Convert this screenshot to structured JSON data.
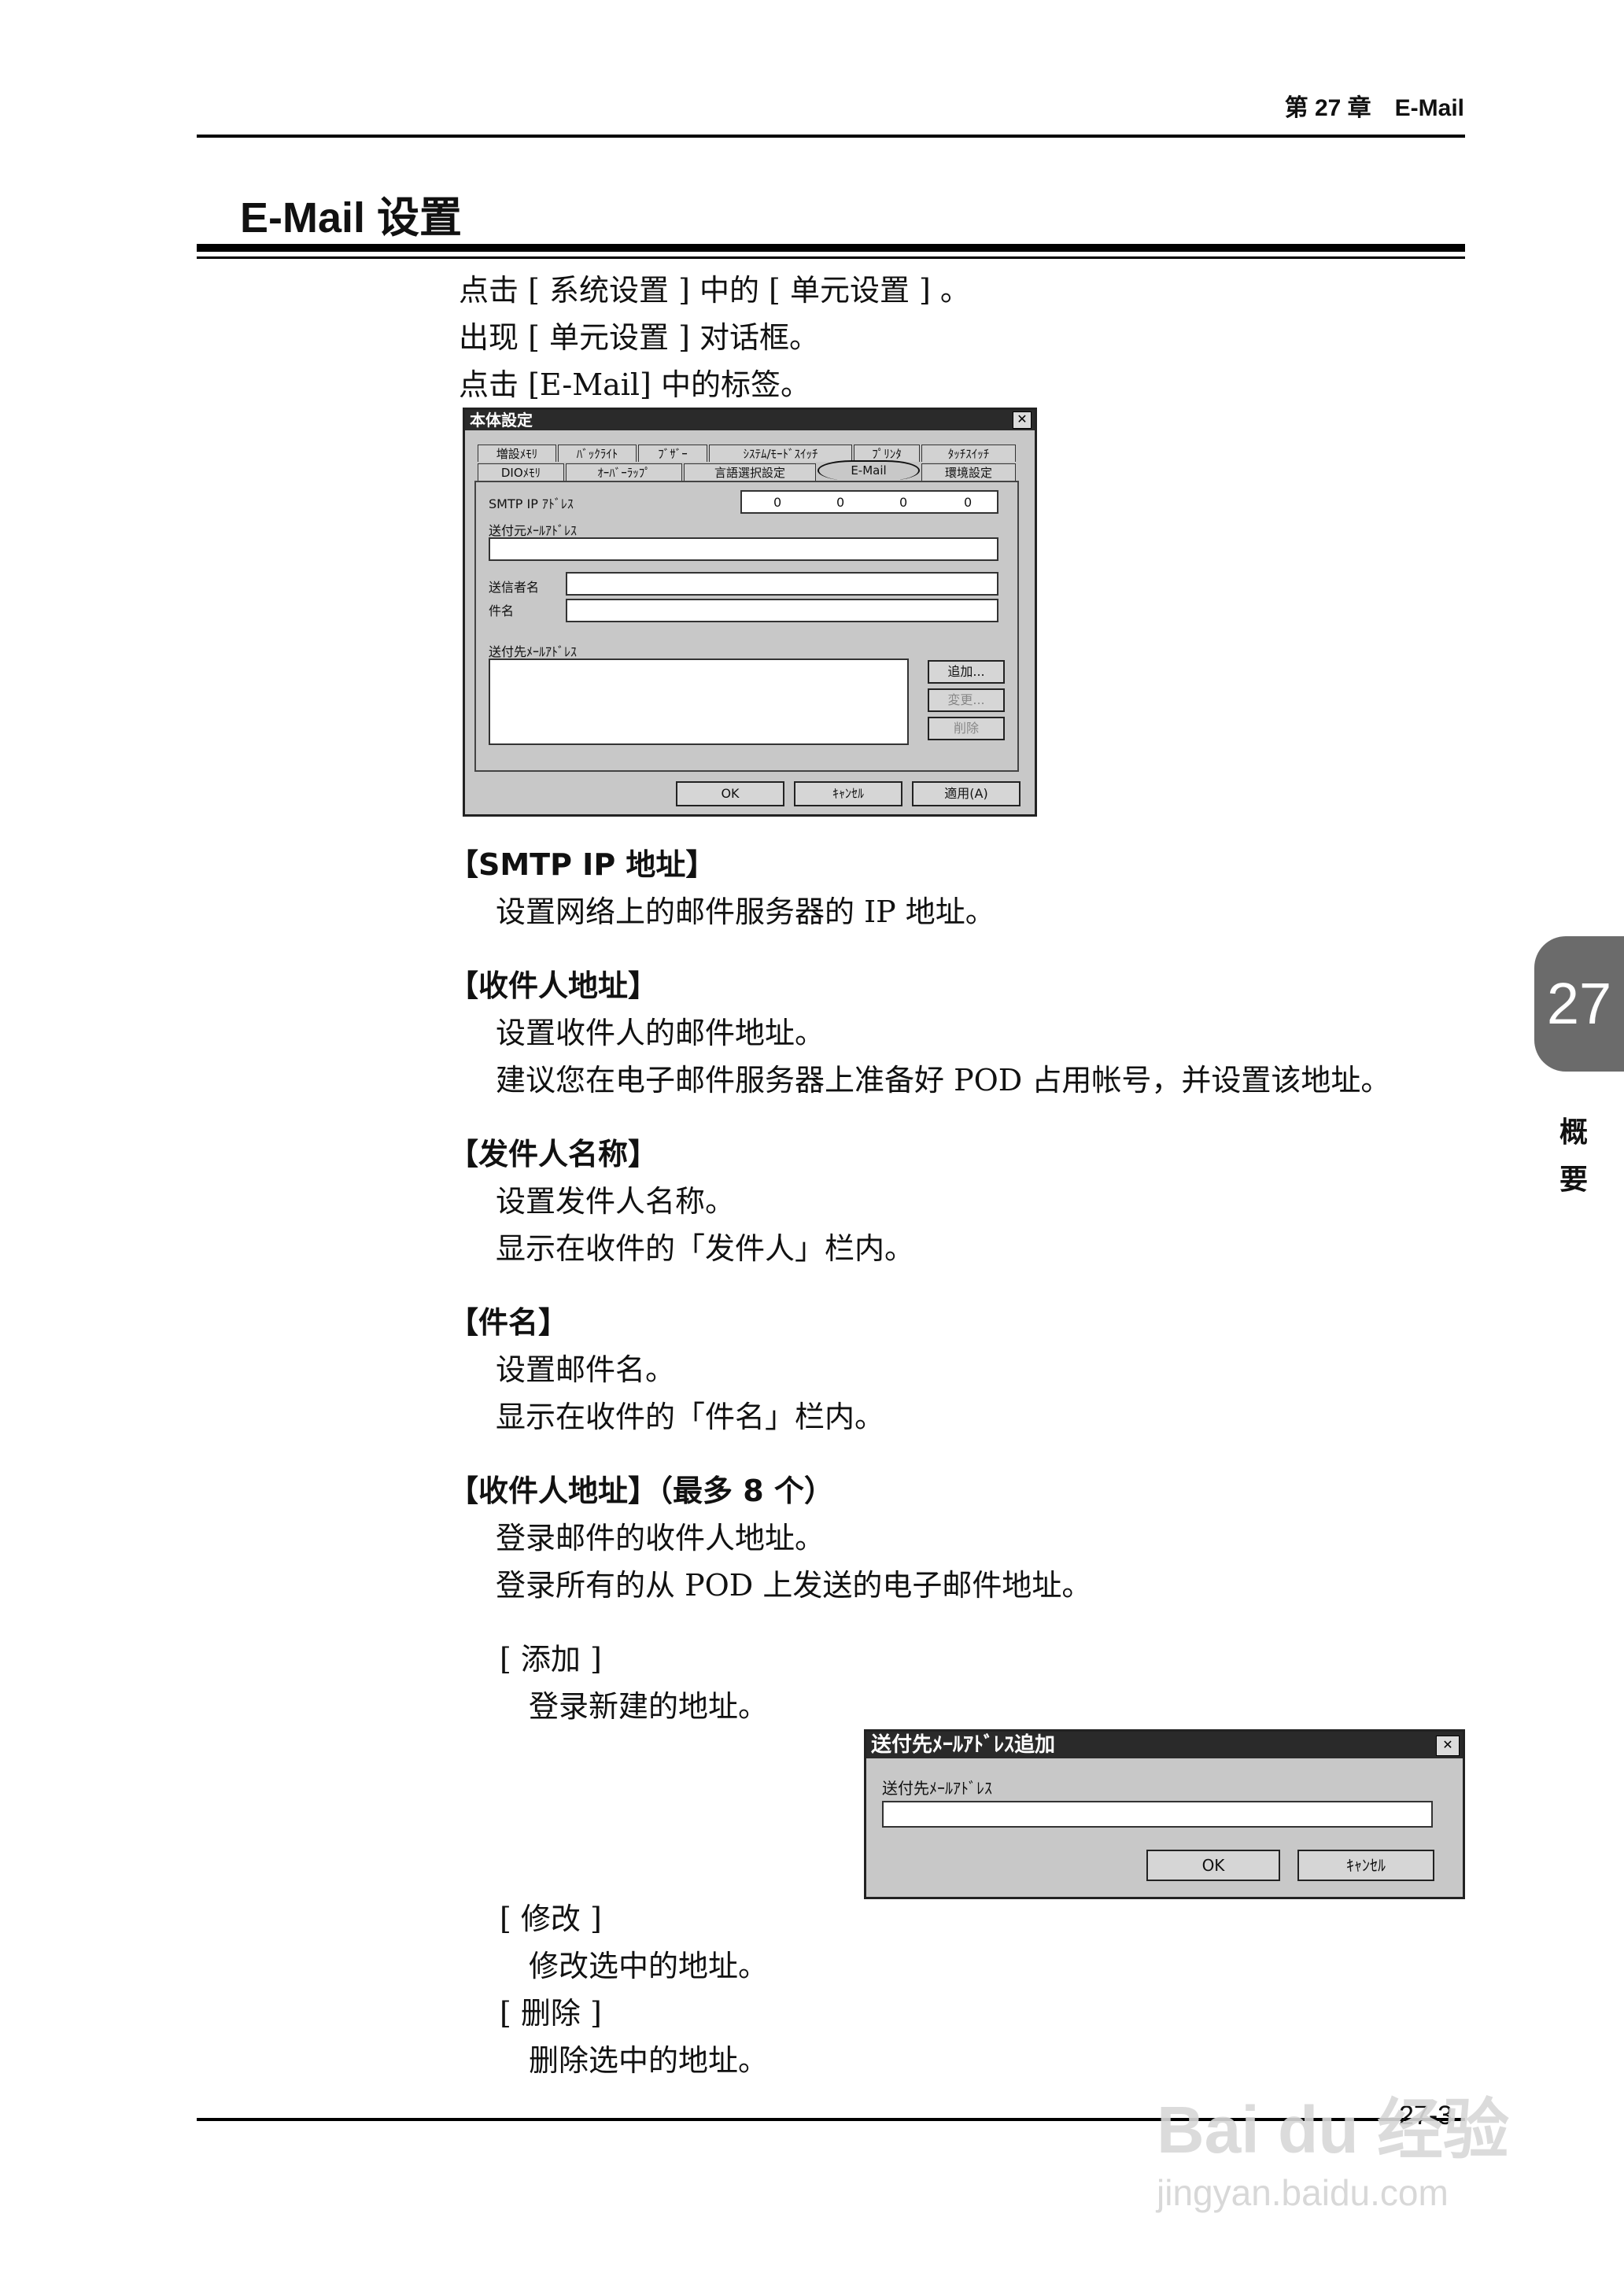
{
  "header": {
    "chapter_label": "第 27 章　E-Mail"
  },
  "title": "E-Mail 设置",
  "intro": [
    "点击 [ 系统设置 ] 中的 [ 单元设置 ] 。",
    "出现 [ 单元设置 ] 对话框。",
    "点击 [E-Mail] 中的标签。"
  ],
  "dialog_main": {
    "title": "本体設定",
    "tabs_row1": [
      "増設ﾒﾓﾘ",
      "ﾊﾞｯｸﾗｲﾄ",
      "ﾌﾞｻﾞｰ",
      "ｼｽﾃﾑ/ﾓｰﾄﾞｽｲｯﾁ",
      "ﾌﾟﾘﾝﾀ",
      "ﾀｯﾁｽｲｯﾁ"
    ],
    "tabs_row2": [
      "DIOﾒﾓﾘ",
      "ｵｰﾊﾞｰﾗｯﾌﾟ",
      "言語選択設定",
      "E-Mail",
      "環境設定"
    ],
    "smtp_label": "SMTP IP ｱﾄﾞﾚｽ",
    "ip_values": [
      "0",
      "0",
      "0",
      "0"
    ],
    "sender_addr_label": "送付元ﾒｰﾙｱﾄﾞﾚｽ",
    "sender_name_label": "送信者名",
    "subject_label": "件名",
    "dest_addr_label": "送付先ﾒｰﾙｱﾄﾞﾚｽ",
    "add_button": "追加...",
    "change_button": "変更...",
    "delete_button": "削除",
    "ok_button": "OK",
    "cancel_button": "ｷｬﾝｾﾙ",
    "apply_button": "適用(A)"
  },
  "sections": [
    {
      "head": "【SMTP IP 地址】",
      "lines": [
        "设置网络上的邮件服务器的 IP 地址。"
      ]
    },
    {
      "head": "【收件人地址】",
      "lines": [
        "设置收件人的邮件地址。",
        "建议您在电子邮件服务器上准备好 POD 占用帐号，并设置该地址。"
      ]
    },
    {
      "head": "【发件人名称】",
      "lines": [
        "设置发件人名称。",
        "显示在收件的「发件人」栏内。"
      ]
    },
    {
      "head": "【件名】",
      "lines": [
        "设置邮件名。",
        "显示在收件的「件名」栏内。"
      ]
    },
    {
      "head": "【收件人地址】（最多 8 个）",
      "lines": [
        "登录邮件的收件人地址。",
        "登录所有的从 POD 上发送的电子邮件地址。"
      ]
    }
  ],
  "subsections": [
    {
      "head": "[ 添加 ]",
      "line": "登录新建的地址。"
    },
    {
      "head": "[ 修改 ]",
      "line": "修改选中的地址。"
    },
    {
      "head": "[ 删除 ]",
      "line": "删除选中的地址。"
    }
  ],
  "dialog_add": {
    "title": "送付先ﾒｰﾙｱﾄﾞﾚｽ追加",
    "field_label": "送付先ﾒｰﾙｱﾄﾞﾚｽ",
    "ok_button": "OK",
    "cancel_button": "ｷｬﾝｾﾙ"
  },
  "side_tab": {
    "number": "27",
    "label_1": "概",
    "label_2": "要"
  },
  "page_number": "27-3",
  "watermark": {
    "brand": "Bai du 经验",
    "url": "jingyan.baidu.com"
  }
}
